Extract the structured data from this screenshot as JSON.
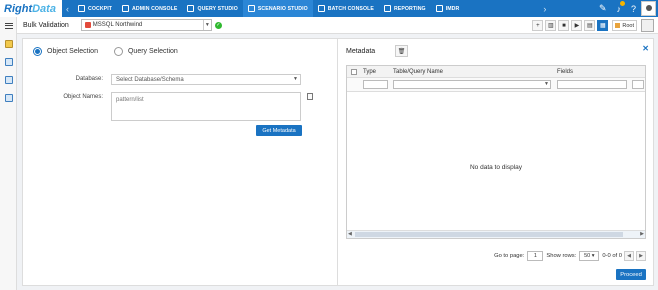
{
  "app": {
    "logo_right": "Right",
    "logo_data": "Data"
  },
  "nav": {
    "items": [
      {
        "label": "COCKPIT",
        "icon": "cockpit-icon"
      },
      {
        "label": "ADMIN CONSOLE",
        "icon": "admin-icon"
      },
      {
        "label": "QUERY STUDIO",
        "icon": "query-icon"
      },
      {
        "label": "SCENARIO STUDIO",
        "icon": "scenario-icon",
        "active": true
      },
      {
        "label": "BATCH CONSOLE",
        "icon": "batch-icon"
      },
      {
        "label": "REPORTING",
        "icon": "reporting-icon"
      },
      {
        "label": "IMDR",
        "icon": "imdr-icon"
      }
    ],
    "left_arrow": "‹",
    "right_arrow": "›"
  },
  "toolbar": {
    "title": "Bulk Validation",
    "datasource": "MSSQL Northwind",
    "root_label": "Root"
  },
  "left": {
    "object_selection": "Object Selection",
    "query_selection": "Query Selection",
    "database_label": "Database:",
    "database_placeholder": "Select Database/Schema",
    "object_names_label": "Object Names:",
    "object_names_placeholder": "pattern/list",
    "get_metadata": "Get Metadata"
  },
  "right": {
    "title": "Metadata",
    "columns": [
      "Type",
      "Table/Query Name",
      "Fields"
    ],
    "empty": "No data to display",
    "go_to_page": "Go to page:",
    "page_value": "1",
    "show_rows": "Show rows:",
    "rows_value": "50",
    "range": "0-0 of 0",
    "proceed": "Proceed"
  },
  "colors": {
    "brand": "#1a73c2",
    "ok": "#2eb82e"
  }
}
